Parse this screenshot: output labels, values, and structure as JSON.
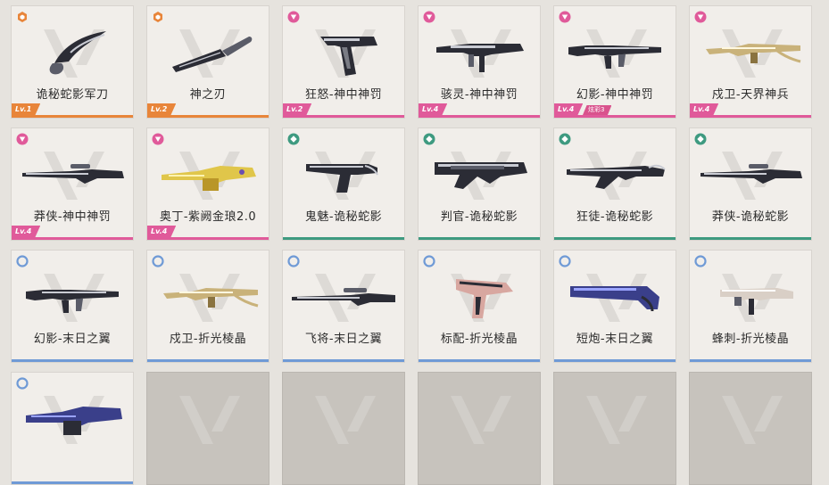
{
  "colors": {
    "orange": "#e8853a",
    "pink": "#e05a9a",
    "green": "#3e9a80",
    "blue": "#6f9ad6"
  },
  "cards": [
    {
      "name": "诡秘蛇影军刀",
      "tier": "orange",
      "level": "Lv.1",
      "icon": "karambit-knife-icon"
    },
    {
      "name": "神之刃",
      "tier": "orange",
      "level": "Lv.2",
      "icon": "combat-knife-icon"
    },
    {
      "name": "狂怒-神中神罚",
      "tier": "pink",
      "level": "Lv.2",
      "icon": "frenzy-pistol-icon"
    },
    {
      "name": "骇灵-神中神罚",
      "tier": "pink",
      "level": "Lv.4",
      "icon": "spectre-smg-icon"
    },
    {
      "name": "幻影-神中神罚",
      "tier": "pink",
      "level": "Lv.4",
      "sub": "炫彩3",
      "icon": "phantom-rifle-icon"
    },
    {
      "name": "戍卫-天界神兵",
      "tier": "pink",
      "level": "Lv.4",
      "icon": "guardian-rifle-icon"
    },
    {
      "name": "莽侠-神中神罚",
      "tier": "pink",
      "level": "Lv.4",
      "icon": "outlaw-sniper-icon"
    },
    {
      "name": "奥丁-紫阙金琅2.0",
      "tier": "pink",
      "level": "Lv.4",
      "icon": "odin-mg-icon"
    },
    {
      "name": "鬼魅-诡秘蛇影",
      "tier": "green",
      "icon": "ghost-pistol-icon"
    },
    {
      "name": "判官-诡秘蛇影",
      "tier": "green",
      "icon": "judge-shotgun-icon"
    },
    {
      "name": "狂徒-诡秘蛇影",
      "tier": "green",
      "icon": "vandal-rifle-icon"
    },
    {
      "name": "莽侠-诡秘蛇影",
      "tier": "green",
      "icon": "outlaw-sniper-icon"
    },
    {
      "name": "幻影-末日之翼",
      "tier": "blue",
      "icon": "phantom-rifle-icon"
    },
    {
      "name": "戍卫-折光棱晶",
      "tier": "blue",
      "icon": "guardian-rifle-icon"
    },
    {
      "name": "飞将-末日之翼",
      "tier": "blue",
      "icon": "marshal-sniper-icon"
    },
    {
      "name": "标配-折光棱晶",
      "tier": "blue",
      "icon": "classic-pistol-icon"
    },
    {
      "name": "短炮-末日之翼",
      "tier": "blue",
      "icon": "shorty-shotgun-icon"
    },
    {
      "name": "蜂刺-折光棱晶",
      "tier": "blue",
      "icon": "stinger-smg-icon"
    },
    {
      "name": "",
      "tier": "blue",
      "icon": "heavy-mg-icon"
    }
  ]
}
